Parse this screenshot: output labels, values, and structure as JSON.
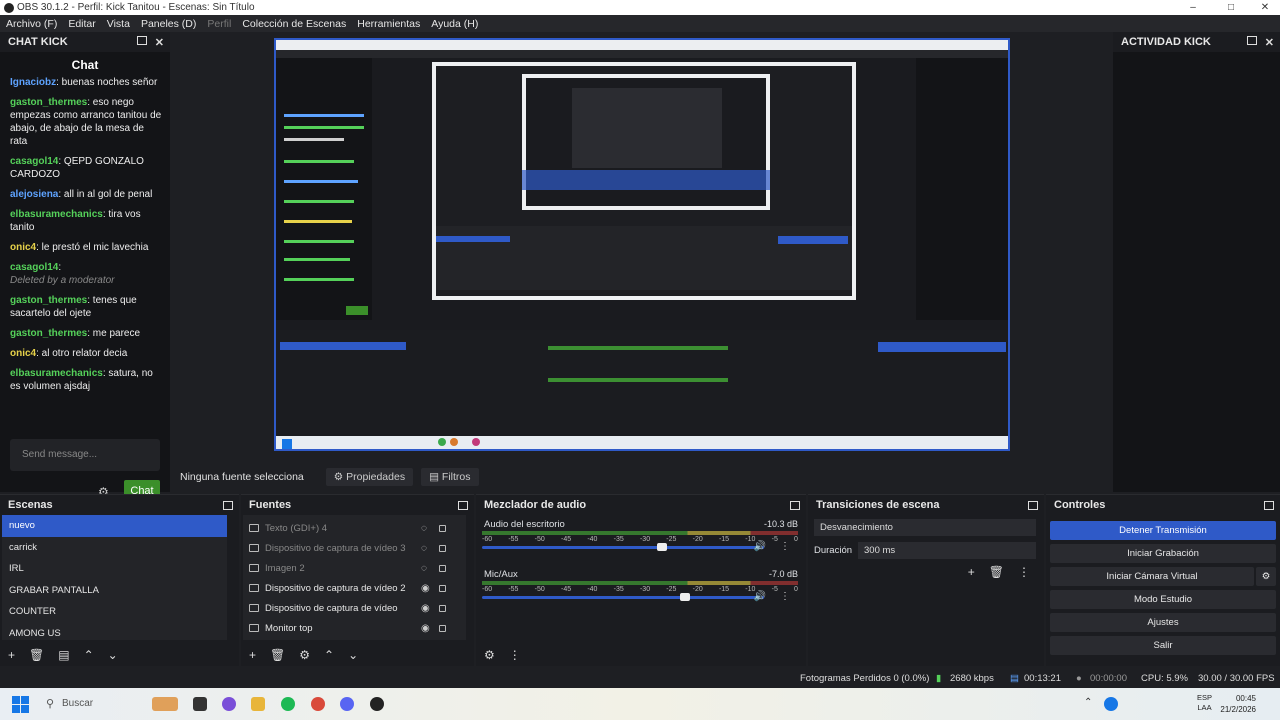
{
  "window": {
    "title": "OBS 30.1.2 - Perfil: Kick Tanitou - Escenas: Sin Título"
  },
  "menu": [
    "Archivo (F)",
    "Editar",
    "Vista",
    "Paneles (D)",
    "Perfil",
    "Colección de Escenas",
    "Herramientas",
    "Ayuda (H)"
  ],
  "chat_dock": {
    "title": "CHAT KICK",
    "header": "Chat",
    "messages": [
      {
        "user": "Ignaciobz",
        "text": ": buenas noches señor",
        "color": "#5ea3ff"
      },
      {
        "user": "gaston_thermes",
        "text": ": eso nego empezas como arranco tanitou de abajo, de abajo de la mesa de rata",
        "color": "#55d15a"
      },
      {
        "user": "casagol14",
        "text": ": QEPD GONZALO CARDOZO",
        "color": "#55d15a"
      },
      {
        "user": "alejosiena",
        "text": ": all in al gol de penal",
        "color": "#5ea3ff"
      },
      {
        "user": "elbasuramechanics",
        "text": ": tira vos tanito",
        "color": "#55d15a"
      },
      {
        "user": "onic4",
        "text": ": le prestó el mic lavechia",
        "color": "#e7d24a"
      },
      {
        "user": "casagol14",
        "text": ":",
        "color": "#55d15a",
        "moderated": "Deleted by a moderator"
      },
      {
        "user": "gaston_thermes",
        "text": ": tenes que sacartelo del ojete",
        "color": "#55d15a"
      },
      {
        "user": "gaston_thermes",
        "text": ": me parece",
        "color": "#55d15a"
      },
      {
        "user": "onic4",
        "text": ": al otro relator decia",
        "color": "#e7d24a"
      },
      {
        "user": "elbasuramechanics",
        "text": ": satura, no es volumen ajsdaj",
        "color": "#55d15a"
      }
    ],
    "input_placeholder": "Send message...",
    "send_label": "Chat"
  },
  "activity_dock": {
    "title": "ACTIVIDAD KICK"
  },
  "source_bar": {
    "label": "Ninguna fuente selecciona",
    "properties": "Propiedades",
    "filters": "Filtros"
  },
  "scenes": {
    "title": "Escenas",
    "items": [
      "nuevo",
      "carrick",
      "IRL",
      "GRABAR PANTALLA",
      "COUNTER",
      "AMONG US"
    ]
  },
  "sources": {
    "title": "Fuentes",
    "items": [
      {
        "label": "Texto (GDI+) 4",
        "dim": true
      },
      {
        "label": "Dispositivo de captura de vídeo 3",
        "dim": true
      },
      {
        "label": "Imagen 2",
        "dim": true
      },
      {
        "label": "Dispositivo de captura de vídeo 2",
        "dim": false
      },
      {
        "label": "Dispositivo de captura de vídeo",
        "dim": false
      },
      {
        "label": "Monitor top",
        "dim": false
      }
    ]
  },
  "mixer": {
    "title": "Mezclador de audio",
    "channels": [
      {
        "name": "Audio del escritorio",
        "db": "-10.3 dB",
        "level": 0.64
      },
      {
        "name": "Mic/Aux",
        "db": "-7.0 dB",
        "level": 0.72
      }
    ],
    "ticks": [
      "-60",
      "-55",
      "-50",
      "-45",
      "-40",
      "-35",
      "-30",
      "-25",
      "-20",
      "-15",
      "-10",
      "-5",
      "0"
    ]
  },
  "transitions": {
    "title": "Transiciones de escena",
    "transition": "Desvanecimiento",
    "duration_label": "Duración",
    "duration_value": "300 ms"
  },
  "controls": {
    "title": "Controles",
    "buttons": [
      "Detener Transmisión",
      "Iniciar Grabación",
      "Iniciar Cámara Virtual",
      "Modo Estudio",
      "Ajustes",
      "Salir"
    ]
  },
  "status": {
    "dropped": "Fotogramas Perdidos 0 (0.0%)",
    "bitrate": "2680 kbps",
    "stream_time": "00:13:21",
    "rec_time": "00:00:00",
    "cpu": "CPU: 5.9%",
    "fps": "30.00 / 30.00 FPS"
  },
  "taskbar": {
    "search": "Buscar",
    "lang1": "ESP",
    "lang2": "LAA",
    "time": "00:45",
    "date": "21/2/2026"
  },
  "colors": {
    "accent": "#2f5ac8",
    "chat_send": "#3b8f2a"
  }
}
